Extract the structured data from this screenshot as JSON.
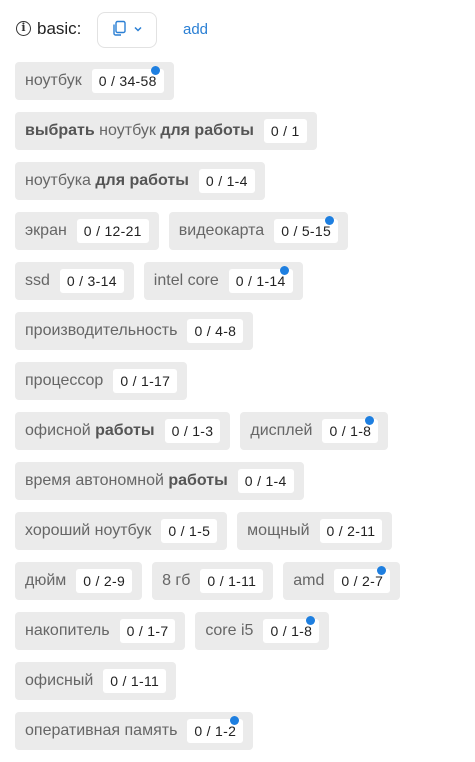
{
  "header": {
    "label": "basic:",
    "add_label": "add",
    "info_icon": "info-icon",
    "copy_icon": "copy-icon",
    "dropdown_icon": "chevron-down-icon"
  },
  "colors": {
    "accent": "#1e7fe0",
    "link": "#2a7fd4",
    "tag_bg": "#ebebeb"
  },
  "tags": [
    {
      "parts": [
        [
          "",
          "ноутбук"
        ]
      ],
      "count": "0 / 34-58",
      "dot": true
    },
    {
      "parts": [
        [
          "b",
          "выбрать"
        ],
        [
          "",
          " ноутбук "
        ],
        [
          "b",
          "для работы"
        ]
      ],
      "count": "0 / 1",
      "dot": false
    },
    {
      "parts": [
        [
          "",
          "ноутбука "
        ],
        [
          "b",
          "для работы"
        ]
      ],
      "count": "0 / 1-4",
      "dot": false
    },
    {
      "parts": [
        [
          "",
          "экран"
        ]
      ],
      "count": "0 / 12-21",
      "dot": false
    },
    {
      "parts": [
        [
          "",
          "видеокарта"
        ]
      ],
      "count": "0 / 5-15",
      "dot": true
    },
    {
      "parts": [
        [
          "",
          "ssd"
        ]
      ],
      "count": "0 / 3-14",
      "dot": false
    },
    {
      "parts": [
        [
          "",
          "intel core"
        ]
      ],
      "count": "0 / 1-14",
      "dot": true
    },
    {
      "parts": [
        [
          "",
          "производительность"
        ]
      ],
      "count": "0 / 4-8",
      "dot": false
    },
    {
      "parts": [
        [
          "",
          "процессор"
        ]
      ],
      "count": "0 / 1-17",
      "dot": false
    },
    {
      "parts": [
        [
          "",
          "офисной "
        ],
        [
          "b",
          "работы"
        ]
      ],
      "count": "0 / 1-3",
      "dot": false
    },
    {
      "parts": [
        [
          "",
          "дисплей"
        ]
      ],
      "count": "0 / 1-8",
      "dot": true
    },
    {
      "parts": [
        [
          "",
          "время автономной "
        ],
        [
          "b",
          "работы"
        ]
      ],
      "count": "0 / 1-4",
      "dot": false
    },
    {
      "parts": [
        [
          "",
          "хороший ноутбук"
        ]
      ],
      "count": "0 / 1-5",
      "dot": false
    },
    {
      "parts": [
        [
          "",
          "мощный"
        ]
      ],
      "count": "0 / 2-11",
      "dot": false
    },
    {
      "parts": [
        [
          "",
          "дюйм"
        ]
      ],
      "count": "0 / 2-9",
      "dot": false
    },
    {
      "parts": [
        [
          "",
          "8 гб"
        ]
      ],
      "count": "0 / 1-11",
      "dot": false
    },
    {
      "parts": [
        [
          "",
          "amd"
        ]
      ],
      "count": "0 / 2-7",
      "dot": true
    },
    {
      "parts": [
        [
          "",
          "накопитель"
        ]
      ],
      "count": "0 / 1-7",
      "dot": false
    },
    {
      "parts": [
        [
          "",
          "core i5"
        ]
      ],
      "count": "0 / 1-8",
      "dot": true
    },
    {
      "parts": [
        [
          "",
          "офисный"
        ]
      ],
      "count": "0 / 1-11",
      "dot": false
    },
    {
      "parts": [
        [
          "",
          "оперативная память"
        ]
      ],
      "count": "0 / 1-2",
      "dot": true
    }
  ]
}
